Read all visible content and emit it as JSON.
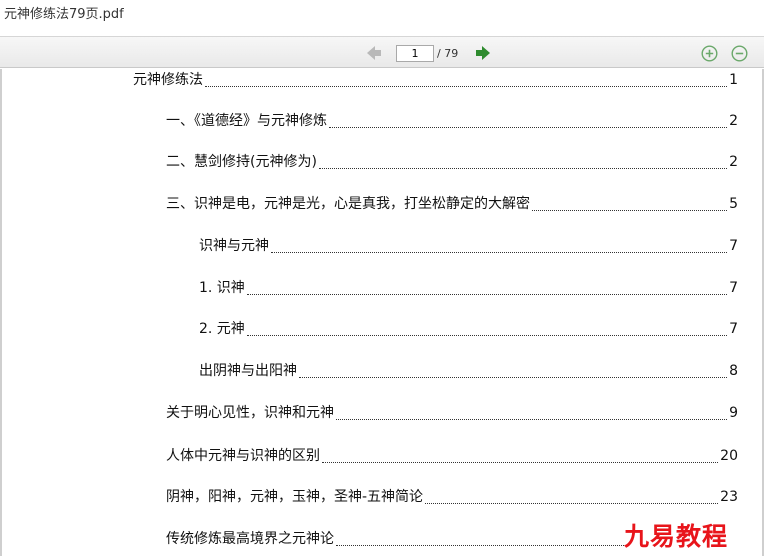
{
  "window": {
    "title": "元神修练法79页.pdf"
  },
  "toolbar": {
    "page_current": "1",
    "page_total": "/ 79",
    "icons": {
      "prev": "arrow-left-icon",
      "next": "arrow-right-icon",
      "zoom_in": "zoom-in-icon",
      "zoom_out": "zoom-out-icon"
    },
    "colors": {
      "next_arrow": "#2e8b2e",
      "prev_arrow": "#b9b9b9",
      "zoom": "#6aa86a"
    }
  },
  "toc": [
    {
      "title": "元神修练法",
      "page": "1"
    },
    {
      "title": "一、《道德经》与元神修炼",
      "page": "2"
    },
    {
      "title": "二、慧剑修持(元神修为)",
      "page": "2"
    },
    {
      "title": "三、识神是电，元神是光，心是真我，打坐松静定的大解密",
      "page": "5"
    },
    {
      "title": "识神与元神",
      "page": "7"
    },
    {
      "title": "1. 识神",
      "page": "7"
    },
    {
      "title": "2. 元神",
      "page": "7"
    },
    {
      "title": "出阴神与出阳神",
      "page": "8"
    },
    {
      "title": "关于明心见性，识神和元神",
      "page": "9"
    },
    {
      "title": "人体中元神与识神的区别",
      "page": "20"
    },
    {
      "title": "阴神，阳神，元神，玉神，圣神-五神简论",
      "page": "23"
    },
    {
      "title": "传统修炼最高境界之元神论",
      "page": ""
    }
  ],
  "watermark": {
    "text": "九易教程",
    "color": "#e8151b"
  }
}
